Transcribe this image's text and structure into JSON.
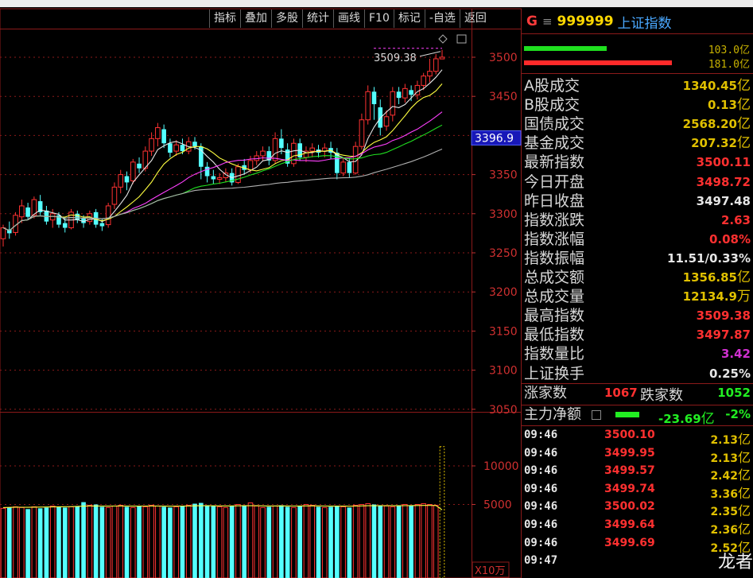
{
  "toolbar": {
    "buttons": [
      "指标",
      "叠加",
      "多股",
      "统计",
      "画线",
      "F10",
      "标记",
      "-自选",
      "返回"
    ]
  },
  "chart": {
    "price_axis": [
      "3500",
      "3450",
      "3400",
      "3350",
      "3300",
      "3250",
      "3200",
      "3150",
      "3100",
      "3050"
    ],
    "price_tag": "3396.9",
    "high_label": "3509.38",
    "volume_axis": [
      "10000",
      "5000"
    ],
    "volume_unit": "X10万",
    "colors": {
      "up": "#ff3232",
      "down": "#54ffff",
      "ma5": "#e6e6e6",
      "ma10": "#ffff40",
      "ma20": "#ff40ff",
      "ma30": "#20e020",
      "ma60": "#b0b0b0",
      "grid": "#8b1a1a"
    }
  },
  "chart_data": {
    "type": "candlestick",
    "ylim": [
      3030,
      3550
    ],
    "candles": [
      [
        3268,
        3282,
        3258,
        3286
      ],
      [
        3280,
        3275,
        3268,
        3290
      ],
      [
        3276,
        3298,
        3272,
        3302
      ],
      [
        3296,
        3310,
        3288,
        3318
      ],
      [
        3308,
        3296,
        3292,
        3314
      ],
      [
        3298,
        3318,
        3294,
        3322
      ],
      [
        3316,
        3302,
        3298,
        3324
      ],
      [
        3304,
        3290,
        3286,
        3310
      ],
      [
        3292,
        3300,
        3282,
        3306
      ],
      [
        3298,
        3286,
        3282,
        3302
      ],
      [
        3288,
        3282,
        3276,
        3296
      ],
      [
        3282,
        3302,
        3280,
        3306
      ],
      [
        3300,
        3292,
        3288,
        3304
      ],
      [
        3294,
        3288,
        3282,
        3298
      ],
      [
        3290,
        3300,
        3286,
        3304
      ],
      [
        3302,
        3286,
        3282,
        3306
      ],
      [
        3288,
        3284,
        3278,
        3294
      ],
      [
        3286,
        3310,
        3282,
        3314
      ],
      [
        3312,
        3334,
        3306,
        3340
      ],
      [
        3334,
        3350,
        3326,
        3356
      ],
      [
        3348,
        3340,
        3330,
        3354
      ],
      [
        3342,
        3366,
        3338,
        3370
      ],
      [
        3364,
        3358,
        3352,
        3372
      ],
      [
        3358,
        3380,
        3354,
        3386
      ],
      [
        3380,
        3396,
        3374,
        3404
      ],
      [
        3396,
        3410,
        3386,
        3416
      ],
      [
        3408,
        3390,
        3384,
        3414
      ],
      [
        3390,
        3378,
        3372,
        3396
      ],
      [
        3380,
        3388,
        3374,
        3394
      ],
      [
        3388,
        3380,
        3376,
        3396
      ],
      [
        3380,
        3392,
        3376,
        3398
      ],
      [
        3392,
        3386,
        3382,
        3398
      ],
      [
        3386,
        3360,
        3344,
        3390
      ],
      [
        3360,
        3348,
        3340,
        3366
      ],
      [
        3348,
        3344,
        3338,
        3356
      ],
      [
        3344,
        3346,
        3338,
        3352
      ],
      [
        3346,
        3352,
        3340,
        3358
      ],
      [
        3352,
        3340,
        3336,
        3358
      ],
      [
        3340,
        3360,
        3338,
        3364
      ],
      [
        3362,
        3356,
        3350,
        3370
      ],
      [
        3356,
        3368,
        3352,
        3374
      ],
      [
        3368,
        3374,
        3362,
        3380
      ],
      [
        3374,
        3380,
        3368,
        3386
      ],
      [
        3380,
        3368,
        3362,
        3386
      ],
      [
        3368,
        3396,
        3364,
        3404
      ],
      [
        3396,
        3384,
        3376,
        3408
      ],
      [
        3382,
        3364,
        3360,
        3390
      ],
      [
        3364,
        3390,
        3360,
        3396
      ],
      [
        3390,
        3372,
        3368,
        3396
      ],
      [
        3372,
        3380,
        3366,
        3386
      ],
      [
        3380,
        3384,
        3372,
        3390
      ],
      [
        3382,
        3378,
        3372,
        3388
      ],
      [
        3380,
        3384,
        3372,
        3390
      ],
      [
        3384,
        3378,
        3370,
        3392
      ],
      [
        3378,
        3352,
        3344,
        3384
      ],
      [
        3352,
        3366,
        3348,
        3372
      ],
      [
        3366,
        3352,
        3346,
        3372
      ],
      [
        3352,
        3386,
        3350,
        3392
      ],
      [
        3386,
        3420,
        3382,
        3428
      ],
      [
        3420,
        3456,
        3414,
        3464
      ],
      [
        3456,
        3440,
        3420,
        3462
      ],
      [
        3436,
        3410,
        3400,
        3446
      ],
      [
        3412,
        3424,
        3406,
        3432
      ],
      [
        3426,
        3456,
        3418,
        3462
      ],
      [
        3456,
        3448,
        3440,
        3462
      ],
      [
        3448,
        3460,
        3442,
        3466
      ],
      [
        3458,
        3452,
        3444,
        3464
      ],
      [
        3452,
        3464,
        3446,
        3470
      ],
      [
        3464,
        3476,
        3458,
        3480
      ],
      [
        3476,
        3482,
        3468,
        3498
      ],
      [
        3482,
        3498,
        3478,
        3504
      ],
      [
        3497.87,
        3500.11,
        3497.87,
        3509.38
      ]
    ],
    "volumes": [
      4500,
      4600,
      4700,
      4600,
      4400,
      4700,
      4500,
      4600,
      4800,
      4700,
      4600,
      4700,
      4800,
      5300,
      4900,
      5000,
      4700,
      4600,
      4800,
      4900,
      4700,
      4600,
      4800,
      4700,
      4900,
      4800,
      4700,
      4600,
      4700,
      4800,
      4900,
      5100,
      5200,
      4900,
      4800,
      4700,
      4600,
      4800,
      5000,
      4900,
      5200,
      4800,
      4600,
      4700,
      4800,
      4900,
      4700,
      4600,
      4800,
      5000,
      4900,
      4700,
      4600,
      4700,
      4800,
      4700,
      4600,
      4900,
      5000,
      5100,
      5000,
      4900,
      4800,
      4700,
      4900,
      5000,
      4900,
      5000,
      5100,
      5000,
      4900,
      12500
    ],
    "volume_ma": [
      4600,
      4620,
      4650,
      4640,
      4630,
      4650,
      4660,
      4670,
      4680,
      4700,
      4710,
      4720,
      4750,
      4780,
      4800,
      4800,
      4790,
      4780,
      4790,
      4800,
      4790,
      4780,
      4790,
      4790,
      4800,
      4790,
      4780,
      4770,
      4780,
      4790,
      4800,
      4820,
      4840,
      4830,
      4820,
      4810,
      4800,
      4810,
      4820,
      4830,
      4840,
      4830,
      4810,
      4800,
      4800,
      4810,
      4800,
      4790,
      4800,
      4810,
      4820,
      4810,
      4790,
      4780,
      4790,
      4780,
      4770,
      4790,
      4810,
      4830,
      4840,
      4850,
      4840,
      4830,
      4840,
      4850,
      4860,
      4870,
      4880,
      4880,
      4870,
      4300
    ]
  },
  "side": {
    "flag": "G",
    "menu_icon": "≡",
    "code": "999999",
    "name": "上证指数",
    "bar1_value": "103.0亿",
    "bar2_value": "181.0亿",
    "stats": [
      {
        "label": "A股成交",
        "value": "1340.45",
        "unit": "亿",
        "color": "#e0c000"
      },
      {
        "label": "B股成交",
        "value": "0.13",
        "unit": "亿",
        "color": "#e0c000"
      },
      {
        "label": "国债成交",
        "value": "2568.20",
        "unit": "亿",
        "color": "#e0c000"
      },
      {
        "label": "基金成交",
        "value": "207.32",
        "unit": "亿",
        "color": "#e0c000"
      },
      {
        "label": "最新指数",
        "value": "3500.11",
        "unit": "",
        "color": "#ff3030"
      },
      {
        "label": "今日开盘",
        "value": "3498.72",
        "unit": "",
        "color": "#ff3030"
      },
      {
        "label": "昨日收盘",
        "value": "3497.48",
        "unit": "",
        "color": "#e6e6e6"
      },
      {
        "label": "指数涨跌",
        "value": "2.63",
        "unit": "",
        "color": "#ff3030"
      },
      {
        "label": "指数涨幅",
        "value": "0.08%",
        "unit": "",
        "color": "#ff3030"
      },
      {
        "label": "指数振幅",
        "value": "11.51/0.33%",
        "unit": "",
        "color": "#e6e6e6"
      },
      {
        "label": "总成交额",
        "value": "1356.85",
        "unit": "亿",
        "color": "#e0c000"
      },
      {
        "label": "总成交量",
        "value": "12134.9",
        "unit": "万",
        "color": "#e0c000"
      },
      {
        "label": "最高指数",
        "value": "3509.38",
        "unit": "",
        "color": "#ff3030"
      },
      {
        "label": "最低指数",
        "value": "3497.87",
        "unit": "",
        "color": "#ff3030"
      },
      {
        "label": "指数量比",
        "value": "3.42",
        "unit": "",
        "color": "#d030d0"
      },
      {
        "label": "上证换手",
        "value": "0.25%",
        "unit": "",
        "color": "#e6e6e6"
      }
    ],
    "rise_label": "涨家数",
    "rise_value": "1067",
    "fall_label": "跌家数",
    "fall_value": "1052",
    "mainflow_label": "主力净额",
    "mainflow_value": "-23.69",
    "mainflow_unit": "亿",
    "mainflow_pct": "-2%",
    "ticks": [
      {
        "time": "09:46",
        "price": "3500.10",
        "amount": "2.13",
        "unit": "亿"
      },
      {
        "time": "09:46",
        "price": "3499.95",
        "amount": "2.13",
        "unit": "亿"
      },
      {
        "time": "09:46",
        "price": "3499.57",
        "amount": "2.42",
        "unit": "亿"
      },
      {
        "time": "09:46",
        "price": "3499.74",
        "amount": "3.36",
        "unit": "亿"
      },
      {
        "time": "09:46",
        "price": "3500.02",
        "amount": "2.35",
        "unit": "亿"
      },
      {
        "time": "09:46",
        "price": "3499.64",
        "amount": "2.36",
        "unit": "亿"
      },
      {
        "time": "09:46",
        "price": "3499.69",
        "amount": "2.52",
        "unit": "亿"
      },
      {
        "time": "09:47",
        "price": "",
        "amount": "",
        "unit": ""
      }
    ]
  },
  "watermark": "龙者"
}
